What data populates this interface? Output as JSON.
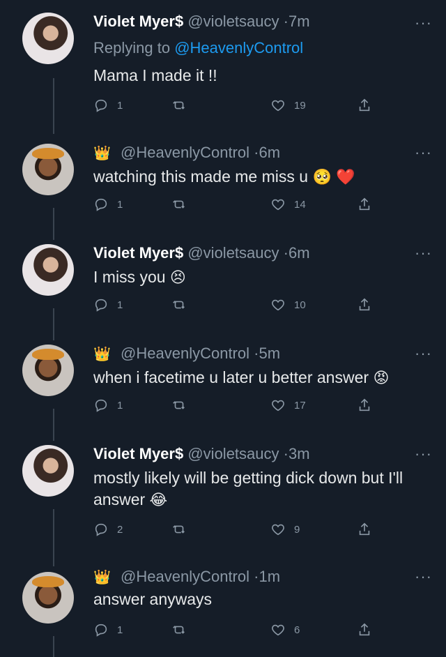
{
  "tweets": [
    {
      "author": "violet",
      "name": "Violet Myer$",
      "handle": "@violetsaucy",
      "sep": "·",
      "time": "7m",
      "replying_prefix": "Replying to ",
      "replying_to": "@HeavenlyControl",
      "text": "Mama I made it !!",
      "replies": "1",
      "likes": "19"
    },
    {
      "author": "heavenly",
      "crown": "👑",
      "handle": "@HeavenlyControl",
      "sep": "·",
      "time": "6m",
      "text": "watching this made me miss u",
      "emoji": "🥺 ❤️",
      "replies": "1",
      "likes": "14"
    },
    {
      "author": "violet",
      "name": "Violet Myer$",
      "handle": "@violetsaucy",
      "sep": "·",
      "time": "6m",
      "text": "I miss you",
      "emoji": "😣",
      "replies": "1",
      "likes": "10"
    },
    {
      "author": "heavenly",
      "crown": "👑",
      "handle": "@HeavenlyControl",
      "sep": "·",
      "time": "5m",
      "text": "when i facetime u later u better answer",
      "emoji": "😡",
      "replies": "1",
      "likes": "17"
    },
    {
      "author": "violet",
      "name": "Violet Myer$",
      "handle": "@violetsaucy",
      "sep": "·",
      "time": "3m",
      "text": "mostly likely will be getting dick down but I'll answer",
      "emoji": "😂",
      "replies": "2",
      "likes": "9"
    },
    {
      "author": "heavenly",
      "crown": "👑",
      "handle": "@HeavenlyControl",
      "sep": "·",
      "time": "1m",
      "text": "answer anyways",
      "replies": "1",
      "likes": "6"
    }
  ],
  "more_label": "···",
  "icons": {
    "reply": "reply-icon",
    "retweet": "retweet-icon",
    "like": "heart-icon",
    "share": "share-icon"
  },
  "colors": {
    "background": "#151d28",
    "text": "#e7e9ea",
    "muted": "#8b98a5",
    "link": "#1d9bf0"
  }
}
